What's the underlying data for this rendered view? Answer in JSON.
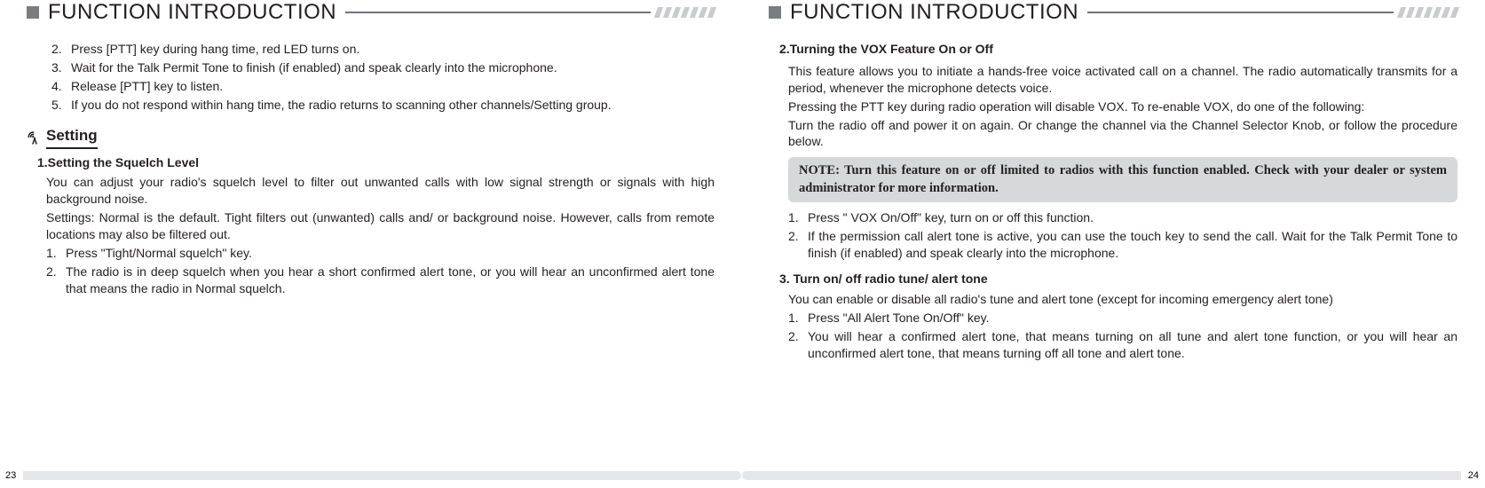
{
  "left": {
    "header": "FUNCTION INTRODUCTION",
    "steps": [
      {
        "n": "2.",
        "t": "Press [PTT] key during hang time, red LED turns on."
      },
      {
        "n": "3.",
        "t": "Wait for the Talk Permit Tone to finish (if enabled) and speak clearly into the microphone."
      },
      {
        "n": "4.",
        "t": "Release [PTT] key to listen."
      },
      {
        "n": "5.",
        "t": "If you do not respond within hang time, the radio returns to scanning other channels/Setting group."
      }
    ],
    "section_title": "Setting",
    "sub1_title": "1.Setting the Squelch Level",
    "sub1_p1": "You can adjust your radio's squelch level to filter out unwanted calls with low signal strength or signals with high background noise.",
    "sub1_p2": "Settings: Normal is the default. Tight filters out (unwanted) calls and/ or background noise. However, calls from remote locations may also be filtered out.",
    "sub1_list": [
      {
        "n": "1.",
        "t": "Press  \"Tight/Normal squelch\" key."
      },
      {
        "n": "2.",
        "t": "The radio is in deep squelch when you hear a short confirmed alert tone, or you will hear an unconfirmed alert tone that means the radio in Normal squelch."
      }
    ],
    "page_num": "23"
  },
  "right": {
    "header": "FUNCTION INTRODUCTION",
    "sub2_title": "2.Turning the VOX Feature On or Off",
    "sub2_p1": "This feature allows you to initiate a hands-free voice activated call on a channel. The radio automatically transmits for a period, whenever the microphone detects voice.",
    "sub2_p2": "Pressing the PTT key during radio operation will disable VOX. To re-enable VOX, do one of the following:",
    "sub2_p3": "Turn the radio off and power it on again. Or change the channel via the Channel Selector Knob, or follow the procedure below.",
    "note": "NOTE: Turn this feature on or off limited to radios with this function enabled. Check with your dealer or system administrator for more information.",
    "sub2_list": [
      {
        "n": "1.",
        "t": "Press \" VOX On/Off\" key, turn on or off this function."
      },
      {
        "n": "2.",
        "t": "If the permission call alert tone is active, you can use the touch key to send the call. Wait for the Talk Permit Tone to finish (if enabled) and speak clearly into the microphone."
      }
    ],
    "sub3_title": "3. Turn on/ off radio tune/ alert tone",
    "sub3_p1": "You can enable or disable all radio's tune and alert tone (except for incoming emergency alert tone)",
    "sub3_list": [
      {
        "n": "1.",
        "t": "Press  \"All Alert Tone On/Off\" key."
      },
      {
        "n": "2.",
        "t": "You will hear a confirmed alert tone, that means turning on all tune and alert tone function, or you will hear an unconfirmed alert tone, that means turning off all tone and alert tone."
      }
    ],
    "page_num": "24"
  }
}
